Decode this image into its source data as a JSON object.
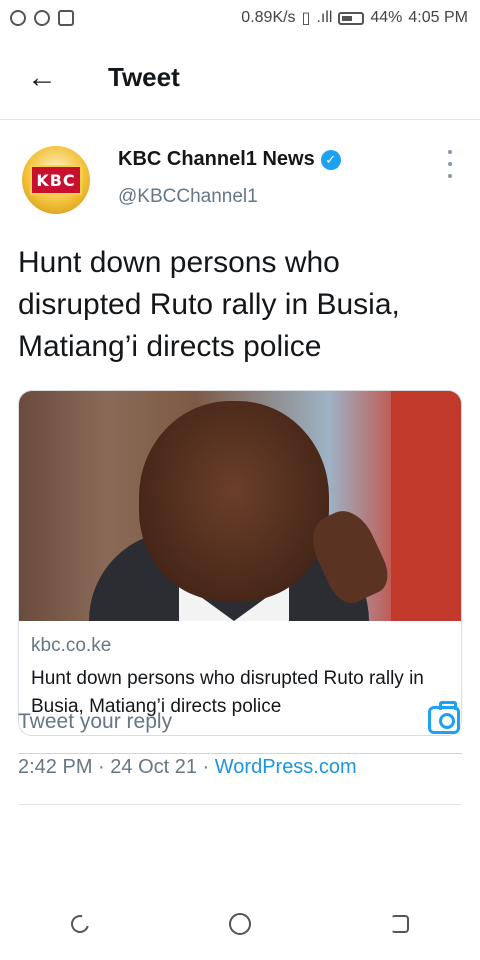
{
  "status_bar": {
    "network_speed": "0.89K/s",
    "battery": "44%",
    "time": "4:05 PM"
  },
  "header": {
    "title": "Tweet"
  },
  "tweet": {
    "author_name": "KBC Channel1 News",
    "author_handle": "@KBCChannel1",
    "avatar_logo_text": "KBC",
    "text": "Hunt down persons who disrupted Ruto rally in Busia, Matiang’i directs police",
    "card": {
      "domain": "kbc.co.ke",
      "title": "Hunt down persons who disrupted Ruto rally in Busia, Matiang’i directs police"
    },
    "time": "2:42 PM",
    "date": "24 Oct 21",
    "source": "WordPress.com"
  },
  "reply": {
    "placeholder": "Tweet your reply"
  },
  "colors": {
    "accent": "#1da1f2",
    "link": "#1b95e0",
    "secondary_text": "#657786"
  }
}
